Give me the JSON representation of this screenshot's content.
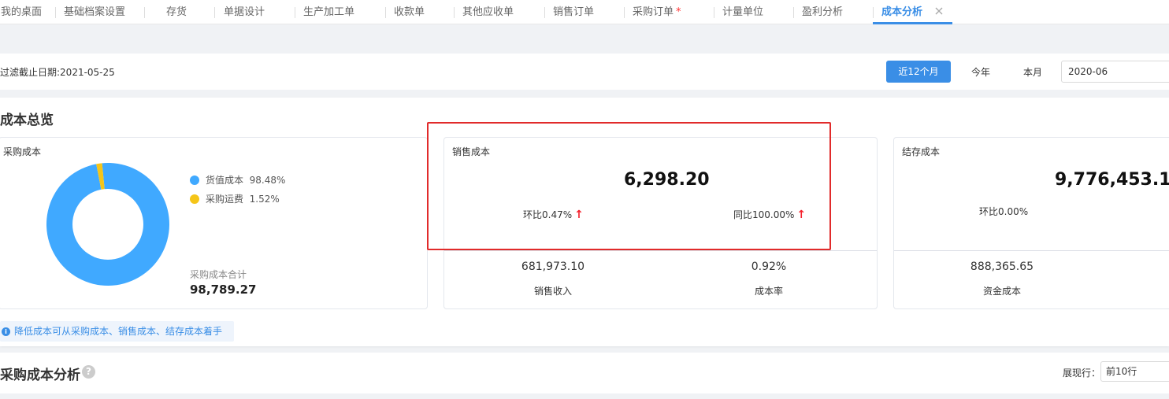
{
  "tabs": [
    {
      "label": "我的桌面"
    },
    {
      "label": "基础档案设置"
    },
    {
      "label": "存货"
    },
    {
      "label": "单据设计"
    },
    {
      "label": "生产加工单"
    },
    {
      "label": "收款单"
    },
    {
      "label": "其他应收单"
    },
    {
      "label": "销售订单"
    },
    {
      "label": "采购订单",
      "required_mark": "*"
    },
    {
      "label": "计量单位"
    },
    {
      "label": "盈利分析"
    },
    {
      "label": "成本分析",
      "active": true
    }
  ],
  "filter": {
    "cutoff_text": "过滤截止日期:2021-05-25",
    "btn_12m": "近12个月",
    "btn_year": "今年",
    "btn_month": "本月",
    "month_value": "2020-06"
  },
  "overview": {
    "title": "成本总览",
    "purchase": {
      "title": "采购成本",
      "legend": [
        {
          "label": "货值成本",
          "pct": "98.48%",
          "color": "#40a9ff",
          "value": 98.48
        },
        {
          "label": "采购运费",
          "pct": "1.52%",
          "color": "#f5c518",
          "value": 1.52
        }
      ],
      "total_label": "采购成本合计",
      "total_value": "98,789.27"
    },
    "sales": {
      "title": "销售成本",
      "value": "6,298.20",
      "mom": "环比0.47%",
      "yoy": "同比100.00%",
      "revenue_value": "681,973.10",
      "revenue_label": "销售收入",
      "rate_value": "0.92%",
      "rate_label": "成本率"
    },
    "inventory": {
      "title": "结存成本",
      "value": "9,776,453.14",
      "mom": "环比0.00%",
      "capital_value": "888,365.65",
      "capital_label": "资金成本"
    },
    "tip": "降低成本可从采购成本、销售成本、结存成本着手"
  },
  "analysis": {
    "title": "采购成本分析",
    "rows_label": "展现行：",
    "rows_value": "前10行"
  }
}
